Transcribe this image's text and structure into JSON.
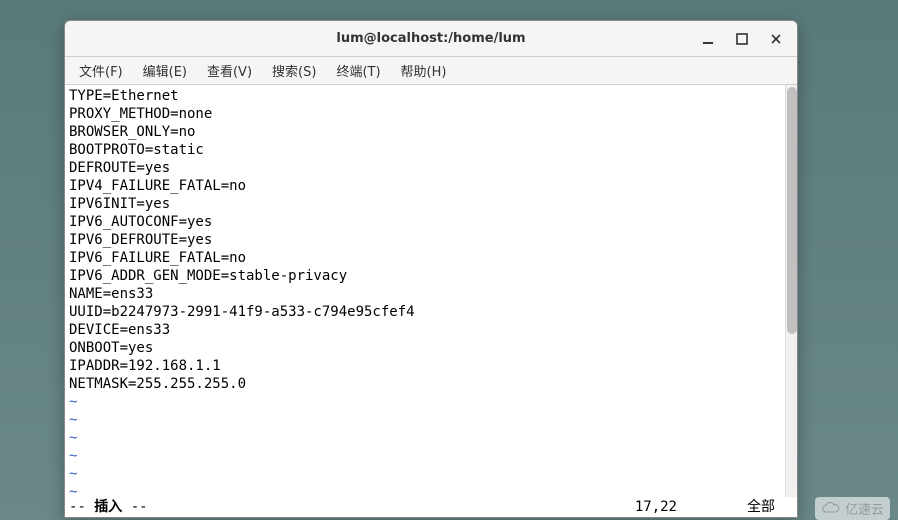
{
  "window": {
    "title": "lum@localhost:/home/lum"
  },
  "menubar": {
    "items": [
      {
        "label": "文件(F)"
      },
      {
        "label": "编辑(E)"
      },
      {
        "label": "查看(V)"
      },
      {
        "label": "搜索(S)"
      },
      {
        "label": "终端(T)"
      },
      {
        "label": "帮助(H)"
      }
    ]
  },
  "editor": {
    "lines": [
      "TYPE=Ethernet",
      "PROXY_METHOD=none",
      "BROWSER_ONLY=no",
      "BOOTPROTO=static",
      "DEFROUTE=yes",
      "IPV4_FAILURE_FATAL=no",
      "IPV6INIT=yes",
      "IPV6_AUTOCONF=yes",
      "IPV6_DEFROUTE=yes",
      "IPV6_FAILURE_FATAL=no",
      "IPV6_ADDR_GEN_MODE=stable-privacy",
      "NAME=ens33",
      "UUID=b2247973-2991-41f9-a533-c794e95cfef4",
      "DEVICE=ens33",
      "ONBOOT=yes",
      "IPADDR=192.168.1.1",
      "NETMASK=255.255.255.0"
    ],
    "tilde_count": 6
  },
  "status": {
    "prefix": "-- ",
    "mode": "插入",
    "suffix": " --",
    "position": "17,22",
    "percent": "全部"
  },
  "watermark": {
    "text": "亿速云"
  }
}
